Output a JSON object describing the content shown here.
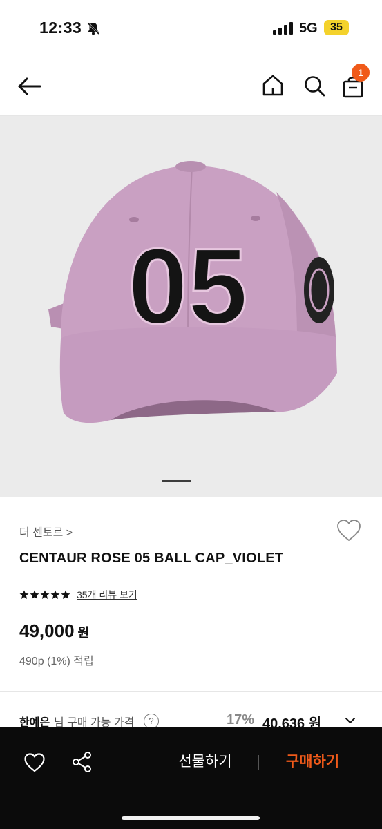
{
  "status_bar": {
    "time": "12:33",
    "network": "5G",
    "battery": "35"
  },
  "header": {
    "cart_count": "1"
  },
  "product": {
    "image_text": "05",
    "image_count": 1,
    "brand": "더 센토르 >",
    "name": "CENTAUR ROSE 05 BALL CAP_VIOLET",
    "rating": 5,
    "review_link": "35개 리뷰 보기",
    "price": "49,000",
    "currency": "원",
    "points": "490p (1%) 적립"
  },
  "member_price": {
    "member_name": "한예은",
    "label": "님 구매 가능 가격",
    "help": "?",
    "discount": "17%",
    "price": "40,636 원"
  },
  "bottom_bar": {
    "gift_label": "선물하기",
    "buy_label": "구매하기"
  },
  "colors": {
    "accent": "#f05a1a",
    "cap": "#c9a0c2",
    "bar": "#0b0b0b"
  }
}
